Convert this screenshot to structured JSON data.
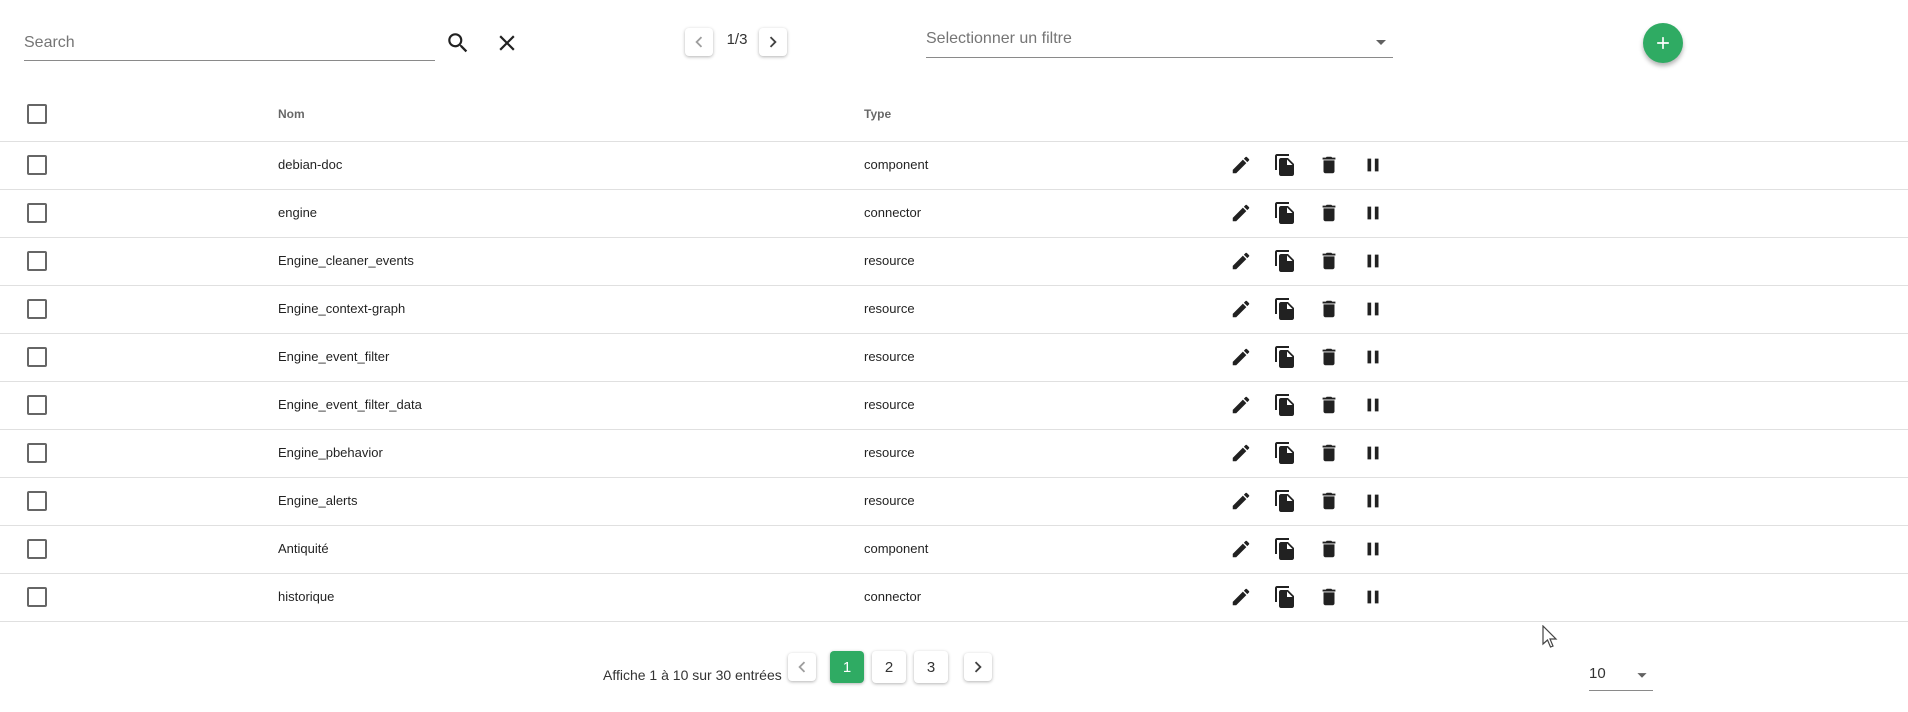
{
  "search": {
    "placeholder": "Search",
    "value": ""
  },
  "top_pagination": {
    "page_label": "1/3"
  },
  "filter": {
    "placeholder": "Selectionner un filtre"
  },
  "table": {
    "columns": [
      "Nom",
      "Type"
    ],
    "rows": [
      {
        "name": "debian-doc",
        "type": "component"
      },
      {
        "name": "engine",
        "type": "connector"
      },
      {
        "name": "Engine_cleaner_events",
        "type": "resource"
      },
      {
        "name": "Engine_context-graph",
        "type": "resource"
      },
      {
        "name": "Engine_event_filter",
        "type": "resource"
      },
      {
        "name": "Engine_event_filter_data",
        "type": "resource"
      },
      {
        "name": "Engine_pbehavior",
        "type": "resource"
      },
      {
        "name": "Engine_alerts",
        "type": "resource"
      },
      {
        "name": "Antiquité",
        "type": "component"
      },
      {
        "name": "historique",
        "type": "connector"
      }
    ],
    "row_actions": [
      "pencil-icon",
      "duplicate-icon",
      "trash-icon",
      "pause-icon"
    ]
  },
  "footer": {
    "entries_text": "Affiche 1 à 10 sur 30 entrées",
    "pages": [
      "1",
      "2",
      "3"
    ],
    "current_page": "1",
    "per_page": "10"
  },
  "colors": {
    "accent": "#2fab63",
    "icon": "#212121",
    "divider": "#e0e0e0"
  }
}
